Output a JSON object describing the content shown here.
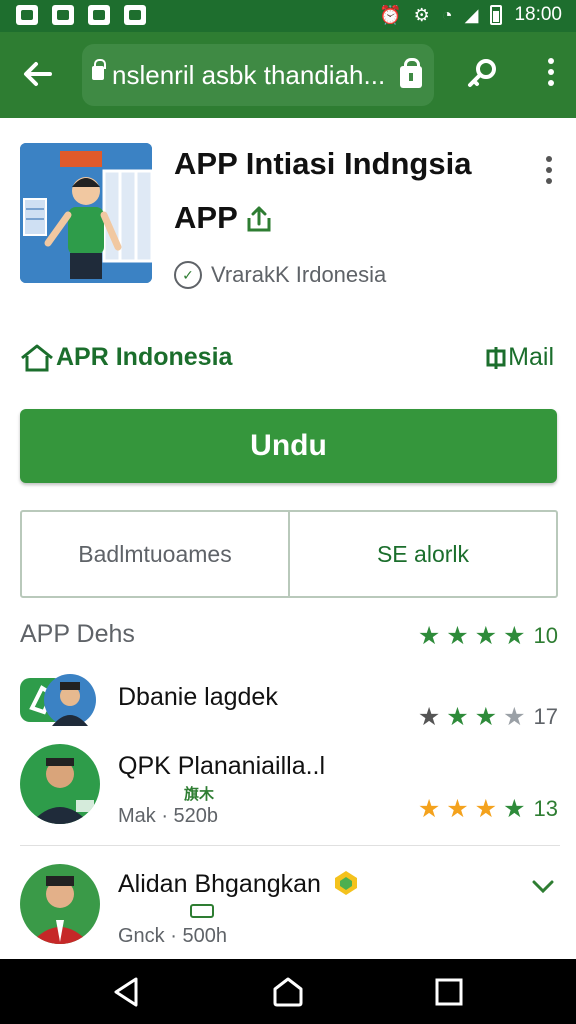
{
  "status_bar": {
    "time": "18:00",
    "icons": [
      "gallery-icon",
      "image-icon",
      "message-icon",
      "notification-icon",
      "alarm-icon",
      "vibrate-icon",
      "wifi-icon",
      "signal-icon",
      "battery-icon"
    ]
  },
  "toolbar": {
    "url": "nslenril asbk thandiah...",
    "icons": [
      "back-arrow-icon",
      "lock-icon",
      "key-icon",
      "overflow-menu-icon"
    ]
  },
  "app": {
    "title": "APP Intiasi Indngsia",
    "subtitle": "APP",
    "developer": "VrarakK Irdonesia",
    "brand": "APR Indonesia",
    "mail_link": "Mail",
    "install_label": "Undu"
  },
  "segment": {
    "left_label": "Badlmtuoames",
    "right_label": "SE alorlk"
  },
  "reviews": {
    "header": "APP Dehs",
    "score": "10",
    "items": [
      {
        "name": "Dbanie lagdek",
        "meta": "",
        "tag": "",
        "score": "17"
      },
      {
        "name": "QPK Plananiailla..l",
        "meta": "Mak · 520b",
        "tag": "旗木",
        "score": "13"
      },
      {
        "name": "Alidan Bhgangkan",
        "meta": "Gnck · 500h",
        "tag": "",
        "score": ""
      }
    ]
  },
  "colors": {
    "primary": "#2e7d32",
    "status_bar": "#1e6e2e",
    "install_button": "#35963c",
    "star_orange": "#f4a21d"
  }
}
